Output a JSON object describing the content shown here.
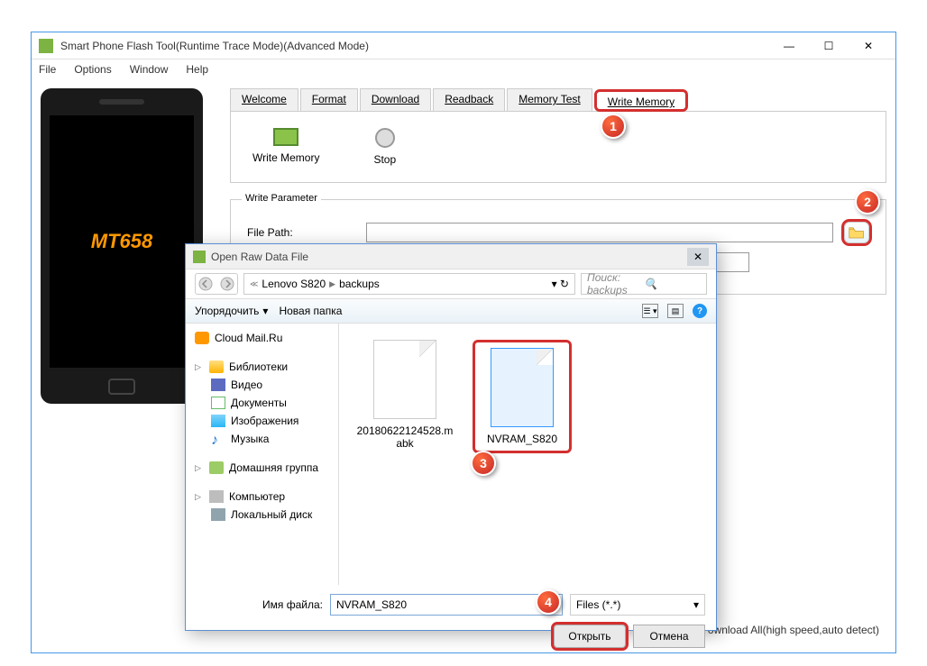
{
  "window": {
    "title": "Smart Phone Flash Tool(Runtime Trace Mode)(Advanced Mode)"
  },
  "menu": {
    "file": "File",
    "options": "Options",
    "window": "Window",
    "help": "Help"
  },
  "phone": {
    "text": "MT658"
  },
  "tabs": {
    "welcome": "Welcome",
    "format": "Format",
    "download": "Download",
    "readback": "Readback",
    "memory_test": "Memory Test",
    "write_memory": "Write Memory"
  },
  "toolbar": {
    "write_memory": "Write Memory",
    "stop": "Stop"
  },
  "param": {
    "title": "Write Parameter",
    "file_path_label": "File Path:"
  },
  "bottom": {
    "text": "ownload All(high speed,auto detect)"
  },
  "dialog": {
    "title": "Open Raw Data File",
    "breadcrumb": {
      "a": "Lenovo S820",
      "b": "backups"
    },
    "search_placeholder": "Поиск: backups",
    "organize": "Упорядочить",
    "new_folder": "Новая папка",
    "sidebar": {
      "cloud": "Cloud Mail.Ru",
      "libraries": "Библиотеки",
      "video": "Видео",
      "documents": "Документы",
      "images": "Изображения",
      "music": "Музыка",
      "homegroup": "Домашняя группа",
      "computer": "Компьютер",
      "localdisk": "Локальный диск"
    },
    "files": {
      "f1": "20180622124528.mabk",
      "f2": "NVRAM_S820"
    },
    "filename_label": "Имя файла:",
    "filename_value": "NVRAM_S820",
    "filetype": "Files (*.*)",
    "open": "Открыть",
    "cancel": "Отмена"
  },
  "callouts": {
    "c1": "1",
    "c2": "2",
    "c3": "3",
    "c4": "4"
  }
}
